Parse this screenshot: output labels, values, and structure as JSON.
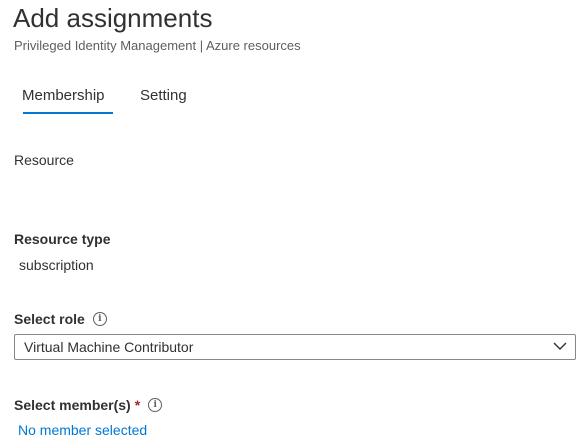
{
  "header": {
    "title": "Add assignments",
    "breadcrumb": "Privileged Identity Management | Azure resources"
  },
  "tabs": [
    {
      "label": "Membership",
      "active": true
    },
    {
      "label": "Setting",
      "active": false
    }
  ],
  "form": {
    "resource_label": "Resource",
    "resource_type_label": "Resource type",
    "resource_type_value": "subscription",
    "select_role_label": "Select role",
    "select_role_value": "Virtual Machine Contributor",
    "select_members_label": "Select member(s)",
    "required_mark": "*",
    "members_link": "No member selected",
    "info_glyph": "i"
  },
  "colors": {
    "accent": "#0078d4",
    "required": "#a4262c"
  },
  "icons": [
    "info-icon",
    "chevron-down-icon"
  ]
}
